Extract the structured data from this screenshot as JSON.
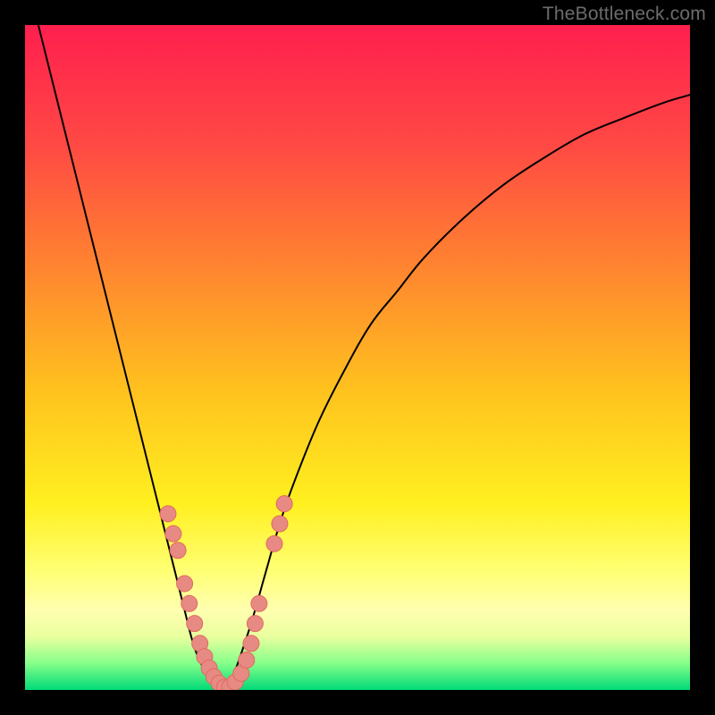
{
  "watermark": "TheBottleneck.com",
  "chart_data": {
    "type": "line",
    "title": "",
    "xlabel": "",
    "ylabel": "",
    "xlim": [
      0,
      100
    ],
    "ylim": [
      0,
      100
    ],
    "grid": false,
    "legend": false,
    "background": {
      "type": "vertical-gradient",
      "stops": [
        {
          "offset": 0.0,
          "color": "#ff1f4e"
        },
        {
          "offset": 0.18,
          "color": "#ff4944"
        },
        {
          "offset": 0.36,
          "color": "#ff8330"
        },
        {
          "offset": 0.55,
          "color": "#ffc21e"
        },
        {
          "offset": 0.72,
          "color": "#fff020"
        },
        {
          "offset": 0.82,
          "color": "#ffff73"
        },
        {
          "offset": 0.88,
          "color": "#ffffb0"
        },
        {
          "offset": 0.92,
          "color": "#e9ff9e"
        },
        {
          "offset": 0.96,
          "color": "#86ff8a"
        },
        {
          "offset": 1.0,
          "color": "#00d978"
        }
      ]
    },
    "series": [
      {
        "name": "left-curve",
        "stroke": "#000000",
        "stroke_width": 2,
        "x": [
          2,
          4,
          6,
          8,
          10,
          12,
          14,
          16,
          18,
          20,
          21,
          22,
          23,
          24,
          25,
          26,
          27,
          28,
          29,
          30
        ],
        "y": [
          100,
          92,
          84,
          76,
          68,
          60,
          52,
          44,
          36,
          28,
          24,
          20,
          16,
          12,
          8,
          5,
          3,
          1.5,
          0.6,
          0
        ]
      },
      {
        "name": "right-curve",
        "stroke": "#000000",
        "stroke_width": 2,
        "x": [
          30,
          31,
          32,
          34,
          36,
          38,
          40,
          44,
          48,
          52,
          56,
          60,
          66,
          72,
          78,
          84,
          90,
          96,
          100
        ],
        "y": [
          0,
          1.5,
          4,
          10,
          17,
          24,
          30,
          40,
          48,
          55,
          60,
          65,
          71,
          76,
          80,
          83.5,
          86,
          88.3,
          89.5
        ]
      }
    ],
    "scatter": {
      "name": "highlight-dots",
      "fill": "#e78a83",
      "stroke": "#e06a60",
      "r": 9,
      "points": [
        {
          "x": 21.5,
          "y": 26.5
        },
        {
          "x": 22.3,
          "y": 23.5
        },
        {
          "x": 23.0,
          "y": 21.0
        },
        {
          "x": 24.0,
          "y": 16.0
        },
        {
          "x": 24.7,
          "y": 13.0
        },
        {
          "x": 25.5,
          "y": 10.0
        },
        {
          "x": 26.3,
          "y": 7.0
        },
        {
          "x": 27.0,
          "y": 5.0
        },
        {
          "x": 27.7,
          "y": 3.3
        },
        {
          "x": 28.4,
          "y": 2.0
        },
        {
          "x": 29.2,
          "y": 1.0
        },
        {
          "x": 30.0,
          "y": 0.4
        },
        {
          "x": 30.8,
          "y": 0.5
        },
        {
          "x": 31.6,
          "y": 1.2
        },
        {
          "x": 32.5,
          "y": 2.5
        },
        {
          "x": 33.3,
          "y": 4.5
        },
        {
          "x": 34.0,
          "y": 7.0
        },
        {
          "x": 34.6,
          "y": 10.0
        },
        {
          "x": 35.2,
          "y": 13.0
        },
        {
          "x": 37.5,
          "y": 22.0
        },
        {
          "x": 38.3,
          "y": 25.0
        },
        {
          "x": 39.0,
          "y": 28.0
        }
      ]
    }
  }
}
